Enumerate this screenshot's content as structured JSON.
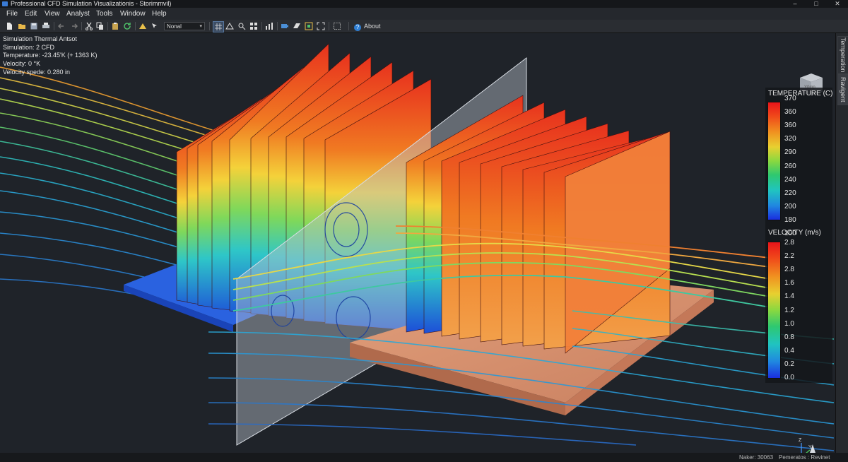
{
  "window": {
    "title": "Professional CFD Simulation Visualizationis - Storimmvil)",
    "min": "–",
    "max": "□",
    "close": "✕"
  },
  "menu": [
    "File",
    "Edit",
    "View",
    "Analyst",
    "Tools",
    "Window",
    "Help"
  ],
  "toolbar": {
    "icons": [
      "new-file-icon",
      "open-folder-icon",
      "save-icon",
      "print-icon",
      "undo-icon",
      "redo-icon",
      "cut-icon",
      "copy-icon",
      "paste-icon",
      "refresh-icon",
      "measure-icon",
      "select-mode-icon"
    ],
    "dropdown_value": "Nonal",
    "icons2": [
      "grid-toggle-icon",
      "mesh-icon",
      "probe-icon",
      "grid-view-icon",
      "chart-icon",
      "camera-icon",
      "slice-icon",
      "fit-view-icon",
      "zoom-region-icon"
    ],
    "about_label": "About"
  },
  "overlay": {
    "line1": "Simulation Thermal Antsot",
    "line2": "Simulation: 2 CFD",
    "line3": "Temperature: -23.45'K (+ 1363 K)",
    "line4": "Velocity: 0 °K",
    "line5": "Velocity spede: 0.280 in"
  },
  "sidetabs": [
    "Temperation",
    "Ravigent"
  ],
  "legend": {
    "temperature": {
      "title": "TEMPERATURE (C)",
      "ticks": [
        "370",
        "360",
        "360",
        "320",
        "290",
        "260",
        "240",
        "220",
        "200",
        "180",
        "100"
      ]
    },
    "velocity": {
      "title": "VELOCITY (m/s)",
      "ticks": [
        "2.8",
        "2.2",
        "2.8",
        "1.6",
        "1.4",
        "1.2",
        "1.0",
        "0.8",
        "0.4",
        "0.2",
        "0.0"
      ]
    }
  },
  "viewcube": {
    "face_label": "Y0mp"
  },
  "triad": {
    "z": "Z",
    "y": "Y",
    "x": "X"
  },
  "status": {
    "left": "Naker: 30063",
    "right": "Pemeratos : Revinet"
  },
  "colors": {
    "hot": "#e8321e",
    "warm": "#f07a22",
    "mid": "#f4d23a",
    "cool": "#3bc9a8",
    "cold": "#1d4fd8",
    "copper": "#d9906c"
  }
}
